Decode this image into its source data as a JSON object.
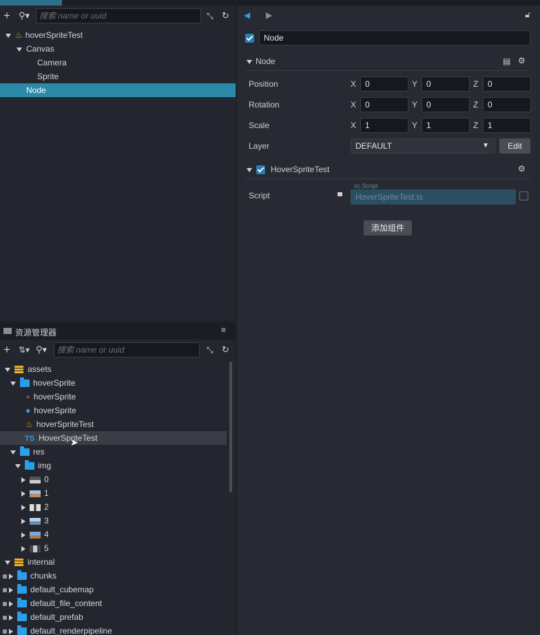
{
  "hierarchy": {
    "search_placeholder": "搜索 name or uuid",
    "nodes": [
      {
        "label": "hoverSpriteTest"
      },
      {
        "label": "Canvas"
      },
      {
        "label": "Camera"
      },
      {
        "label": "Sprite"
      },
      {
        "label": "Node"
      }
    ]
  },
  "assets": {
    "title": "资源管理器",
    "search_placeholder": "搜索 name or uuid",
    "items": [
      {
        "label": "assets"
      },
      {
        "label": "hoverSprite"
      },
      {
        "label": "hoverSprite"
      },
      {
        "label": "hoverSprite"
      },
      {
        "label": "hoverSpriteTest"
      },
      {
        "label": "HoverSpriteTest",
        "prefix": "TS"
      },
      {
        "label": "res"
      },
      {
        "label": "img"
      },
      {
        "label": "0"
      },
      {
        "label": "1"
      },
      {
        "label": "2"
      },
      {
        "label": "3"
      },
      {
        "label": "4"
      },
      {
        "label": "5"
      },
      {
        "label": "internal"
      },
      {
        "label": "chunks"
      },
      {
        "label": "default_cubemap"
      },
      {
        "label": "default_file_content"
      },
      {
        "label": "default_prefab"
      },
      {
        "label": "default_renderpipeline"
      }
    ]
  },
  "inspector": {
    "node_name": "Node",
    "section_title": "Node",
    "position": {
      "label": "Position",
      "x": "0",
      "y": "0",
      "z": "0"
    },
    "rotation": {
      "label": "Rotation",
      "x": "0",
      "y": "0",
      "z": "0"
    },
    "scale": {
      "label": "Scale",
      "x": "1",
      "y": "1",
      "z": "1"
    },
    "axes": {
      "x": "X",
      "y": "Y",
      "z": "Z"
    },
    "layer": {
      "label": "Layer",
      "value": "DEFAULT",
      "edit_label": "Edit"
    },
    "component": {
      "title": "HoverSpriteTest",
      "script_label": "Script",
      "script_type": "cc.Script",
      "script_value": "HoverSpriteTest.ts"
    },
    "add_component_label": "添加组件"
  },
  "colors": {
    "selection": "#2b8aa8",
    "accent": "#2a9ee8",
    "folder": "#2a9ee8"
  }
}
